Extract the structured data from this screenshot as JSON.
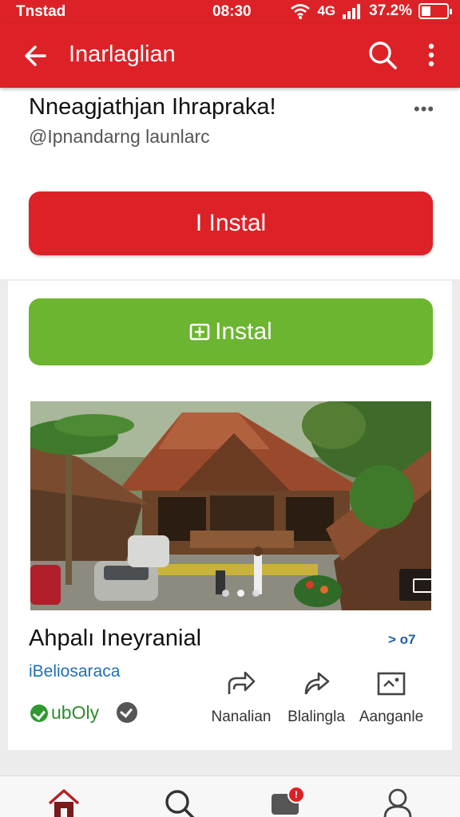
{
  "status_bar": {
    "carrier": "Tnstad",
    "time": "08:30",
    "network": "4G",
    "battery": "37.2%",
    "battery_level": 0.372
  },
  "app_bar": {
    "title": "Inarlaglian",
    "back_icon": "arrow-left-icon",
    "search_icon": "search-icon",
    "more_icon": "more-vertical-icon"
  },
  "app_header": {
    "name": "Nneagjathjan Ihrapraka!",
    "developer": "@Ipnandarng launlarc",
    "overflow": "•••",
    "install_label": "I Instal"
  },
  "secondary": {
    "install_label": "Instal"
  },
  "media": {
    "slide_count": 3,
    "active_slide": 2
  },
  "item": {
    "title": "Ahpalı Ineyranial",
    "meta": "> o7",
    "subtitle": "iBeliosaraca",
    "verified_label": "ubOly"
  },
  "actions": [
    {
      "label": "Nanalian",
      "icon": "share-icon"
    },
    {
      "label": "Blalingla",
      "icon": "forward-icon"
    },
    {
      "label": "Aanganle",
      "icon": "photo-frame-icon"
    }
  ],
  "bottom_nav": {
    "items": [
      "home-icon",
      "search-icon",
      "messages-icon",
      "profile-icon"
    ],
    "badge": "!"
  },
  "colors": {
    "primary": "#dc2227",
    "install_green": "#6cb530",
    "link_blue": "#1f6fb8"
  }
}
